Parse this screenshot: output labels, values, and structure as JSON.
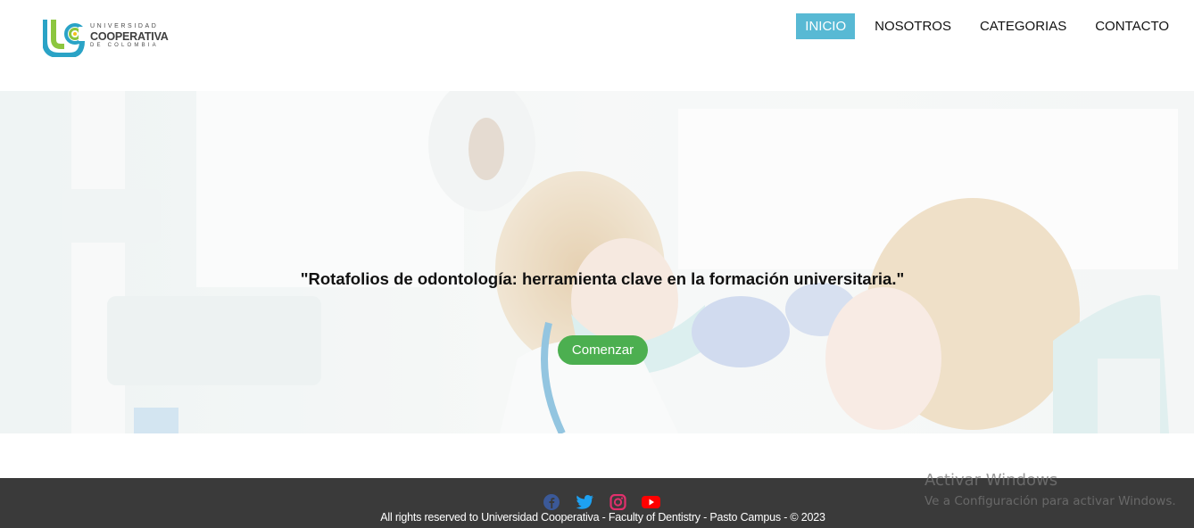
{
  "brand": {
    "logo_alt": "Universidad Cooperativa de Colombia",
    "line1": "UNIVERSIDAD",
    "line2": "COOPERATIVA",
    "line3": "DE COLOMBIA"
  },
  "nav": {
    "items": [
      {
        "label": "INICIO",
        "active": true
      },
      {
        "label": "NOSOTROS",
        "active": false
      },
      {
        "label": "CATEGORIAS",
        "active": false
      },
      {
        "label": "CONTACTO",
        "active": false
      }
    ],
    "active_color": "#58b9d4"
  },
  "hero": {
    "title": "\"Rotafolios de odontología: herramienta clave en la formación universitaria.\"",
    "cta_label": "Comenzar",
    "cta_color": "#4caf50"
  },
  "footer": {
    "social": [
      "facebook-icon",
      "twitter-icon",
      "instagram-icon",
      "youtube-icon"
    ],
    "copyright": "All rights reserved to Universidad Cooperativa - Faculty of Dentistry - Pasto Campus - © 2023",
    "background": "#3a3a3a"
  },
  "watermark": {
    "title": "Activar Windows",
    "subtitle": "Ve a Configuración para activar Windows."
  }
}
